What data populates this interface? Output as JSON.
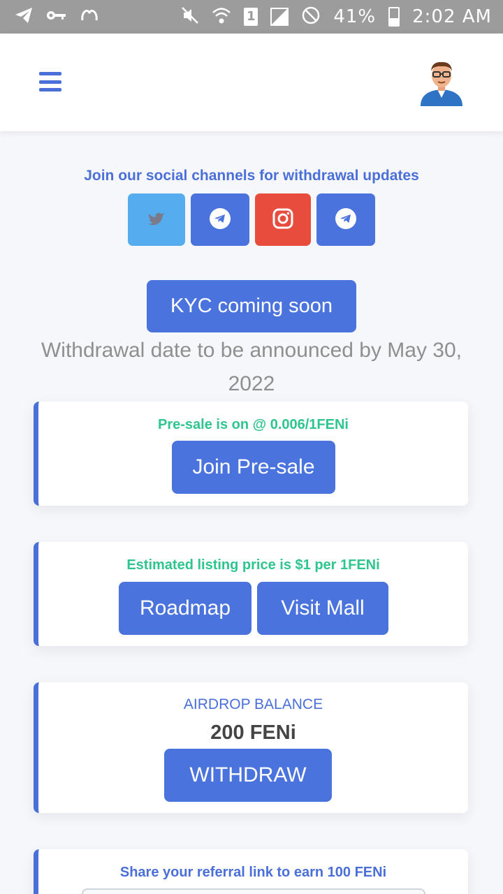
{
  "status_bar": {
    "battery": "41%",
    "time": "2:02 AM",
    "sim": "1",
    "icons": [
      "telegram-icon",
      "key-icon",
      "app-icon",
      "mute-icon",
      "wifi-icon",
      "sim-icon",
      "signal-icon",
      "block-icon",
      "battery-icon"
    ]
  },
  "header": {
    "menu_icon": "hamburger-menu-icon",
    "avatar_icon": "user-avatar-icon"
  },
  "social": {
    "heading": "Join our social channels for withdrawal updates",
    "buttons": [
      {
        "name": "twitter",
        "color": "#55acee"
      },
      {
        "name": "telegram",
        "color": "#4a73de"
      },
      {
        "name": "instagram",
        "color": "#e74c3c"
      },
      {
        "name": "telegram",
        "color": "#4a73de"
      }
    ]
  },
  "kyc": {
    "label": "KYC coming soon"
  },
  "withdrawal_note": "Withdrawal date to be announced by May 30, 2022",
  "presale_card": {
    "title": "Pre-sale is on @ 0.006/1FENi",
    "button": "Join Pre-sale"
  },
  "listing_card": {
    "title": "Estimated listing price is $1 per 1FENi",
    "roadmap_button": "Roadmap",
    "mall_button": "Visit Mall"
  },
  "airdrop_card": {
    "label": "AIRDROP BALANCE",
    "balance": "200 FENi",
    "button": "WITHDRAW"
  },
  "referral_card": {
    "title": "Share your referral link to earn 100 FENi"
  },
  "colors": {
    "accent": "#4a73de",
    "green": "#2ec58e",
    "muted": "#8f8f8f"
  }
}
